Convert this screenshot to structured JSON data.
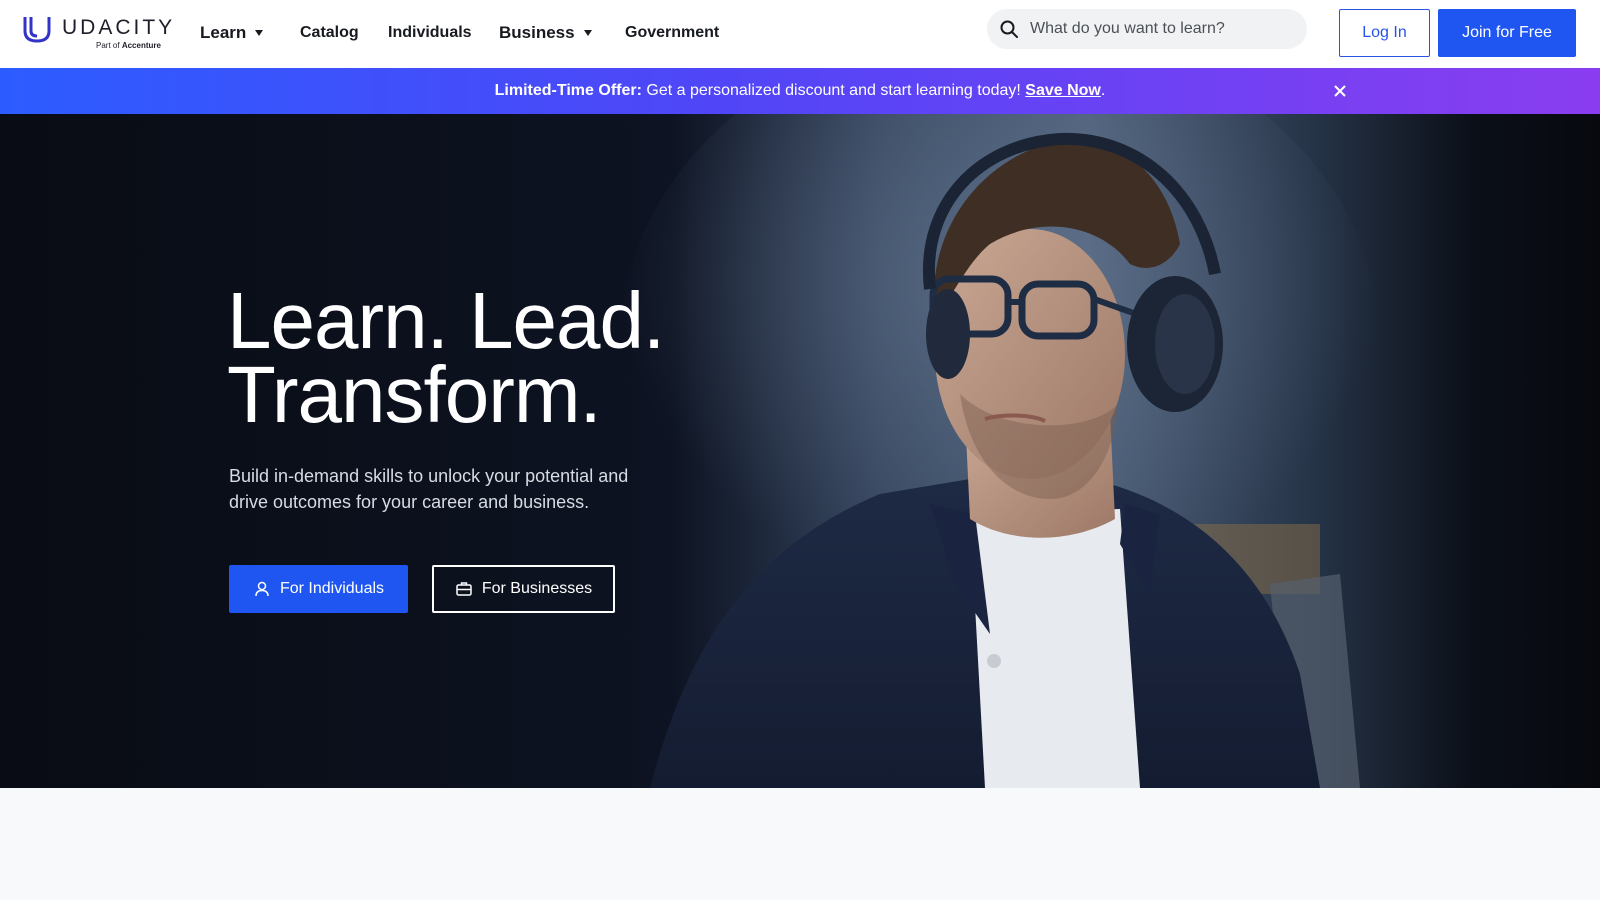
{
  "brand": {
    "name": "UDACITY",
    "tagline_prefix": "Part of",
    "tagline_company": "Accenture",
    "color": "#2d2fc9"
  },
  "nav": {
    "learn": "Learn",
    "catalog": "Catalog",
    "individuals": "Individuals",
    "business": "Business",
    "government": "Government"
  },
  "search": {
    "placeholder": "What do you want to learn?",
    "icon": "search-icon"
  },
  "auth": {
    "login": "Log In",
    "join": "Join for Free"
  },
  "promo": {
    "label": "Limited-Time Offer:",
    "text": " Get a personalized discount and start learning today! ",
    "link": "Save Now",
    "suffix": ".",
    "close_icon": "close-icon"
  },
  "hero": {
    "headline_line1": "Learn. Lead.",
    "headline_line2": "Transform.",
    "subtext": "Build in-demand skills to unlock your potential and drive outcomes for your career and business.",
    "btn_individuals": "For Individuals",
    "btn_businesses": "For Businesses",
    "image": "man-with-headphones-and-glasses-photo"
  },
  "colors": {
    "primary": "#1f56f2",
    "promo_start": "#2c5cff",
    "promo_end": "#8a3df0",
    "hero_bg": "#0b0f1a"
  }
}
